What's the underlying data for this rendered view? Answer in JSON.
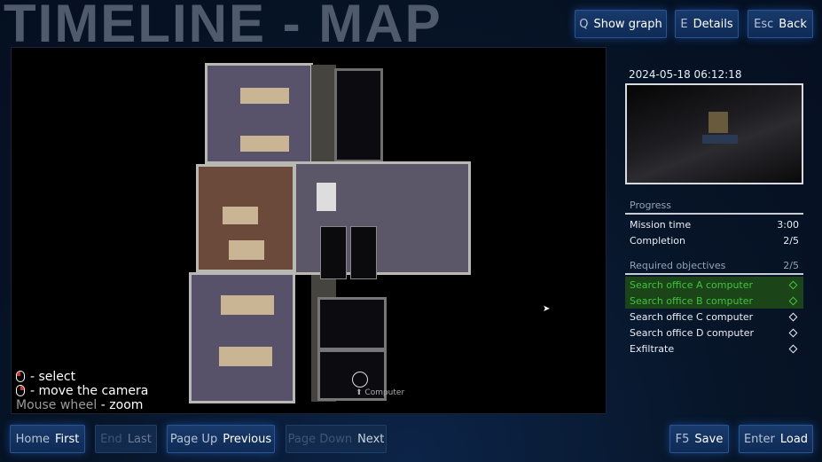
{
  "title": "TIMELINE - MAP",
  "top_buttons": [
    {
      "key": "Q",
      "label": "Show graph"
    },
    {
      "key": "E",
      "label": "Details"
    },
    {
      "key": "Esc",
      "label": "Back"
    }
  ],
  "camera": {
    "timestamp": "2024-05-18 06:12:18"
  },
  "map": {
    "marker_label": "Computer",
    "help": {
      "select": "- select",
      "move": "- move the camera",
      "wheel_key": "Mouse wheel",
      "wheel": "- zoom"
    }
  },
  "progress": {
    "header": "Progress",
    "mission_time_label": "Mission time",
    "mission_time": "3:00",
    "completion_label": "Completion",
    "completion": "2/5"
  },
  "objectives": {
    "header": "Required objectives",
    "count": "2/5",
    "items": [
      {
        "label": "Search office A computer",
        "done": true
      },
      {
        "label": "Search office B computer",
        "done": true
      },
      {
        "label": "Search office C computer",
        "done": false
      },
      {
        "label": "Search office D computer",
        "done": false
      },
      {
        "label": "Exfiltrate",
        "done": false
      }
    ]
  },
  "bottom_buttons": [
    {
      "key": "Home",
      "label": "First",
      "enabled": true
    },
    {
      "key": "End",
      "label": "Last",
      "enabled": false
    },
    {
      "key": "Page Up",
      "label": "Previous",
      "enabled": true
    },
    {
      "key": "Page Down",
      "label": "Next",
      "enabled": false
    },
    {
      "key": "F5",
      "label": "Save",
      "enabled": true
    },
    {
      "key": "Enter",
      "label": "Load",
      "enabled": true
    }
  ],
  "colors": {
    "done": "#3ec43a",
    "done_bg": "#1b4418",
    "button": "#183a6c"
  }
}
